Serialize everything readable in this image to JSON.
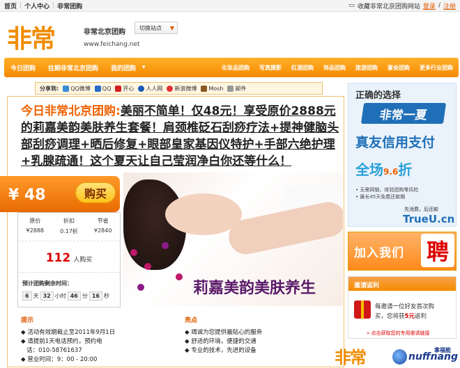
{
  "topbar": {
    "home": "首页",
    "user_center": "个人中心",
    "group_buy": "非常团购",
    "bookmark": "收藏非常北京团购网站",
    "login": "登录",
    "slash": "/",
    "register": "注册"
  },
  "header": {
    "logo": "非常",
    "site_name": "非常北京团购",
    "url": "www.feichang.net",
    "switch_site": "切换站点"
  },
  "nav": {
    "items": [
      "今日团购",
      "往期非常北京团购",
      "我的团购"
    ],
    "right_items": [
      "化妆品团购",
      "写真摄影",
      "红酒团购",
      "饰品团购",
      "旅游团购",
      "宴会团购",
      "更多行业团购"
    ]
  },
  "share": {
    "label": "分享到:",
    "items": [
      "QQ微博",
      "QQ",
      "开心",
      "人人网",
      "新浪微博",
      "Mosh",
      "邮件"
    ]
  },
  "deal": {
    "city": "今日非常北京团购:",
    "title": "美丽不简单！仅48元！享受原价2888元的莉嘉美韵美肤养生套餐！肩颈椎砭石刮痧疗法+提神健脑头部刮痧调理+晒后修复+眼部皇家基因仪特护+手部六绝护理+乳腺疏通！这个夏天让自己莹润净白你还等什么！",
    "price": "¥ 48",
    "buy": "购买",
    "headers": [
      "原价",
      "折扣",
      "节省"
    ],
    "values": [
      "¥2888",
      "0.17折",
      "¥2840"
    ],
    "buyers_count": "112",
    "buyers_label": "人购买",
    "remain_label": "预计团购剩余时间：",
    "timer": {
      "d": "6",
      "d_unit": "天",
      "h": "32",
      "h_unit": "小时",
      "m": "46",
      "m_unit": "分",
      "s": "16",
      "s_unit": "秒"
    },
    "photo_caption": "莉嘉美韵美肤养生"
  },
  "tips": {
    "head": "提示",
    "items": [
      "活动有效期截止至2011年9月1日",
      "请提前1天电话预约，预约电",
      "话：010-58761637",
      "营业时间：9：00 - 20:00"
    ]
  },
  "highlights": {
    "head": "亮点",
    "items": [
      "竭诚为您提供最贴心的服务",
      "舒适的环境，便捷的交通",
      "专业的技术，先进的设备"
    ]
  },
  "ad1": {
    "line1": "正确的选择",
    "line2": "非常一夏",
    "line3": "真友信用支付",
    "line4": "全场",
    "line4_num": "9.6",
    "line4_suffix": "折",
    "line5": "• 无需网银，体验团购零风险",
    "line6": "• 最长45天免费还款期",
    "line7": "先消费，后还款",
    "brand": "TrueU.cn"
  },
  "ad2": {
    "text": "加入我们",
    "char": "聘"
  },
  "invite": {
    "head": "邀请返利",
    "text1": "每邀请一位好友首次购",
    "text2a": "买，您将获",
    "amount": "5元",
    "text2b": "返利",
    "link": "» 点击获取您的专用邀请链接"
  },
  "footer": {
    "logo": "非常",
    "nuff": "nuffnang",
    "nuff_zh": "拿福能"
  }
}
